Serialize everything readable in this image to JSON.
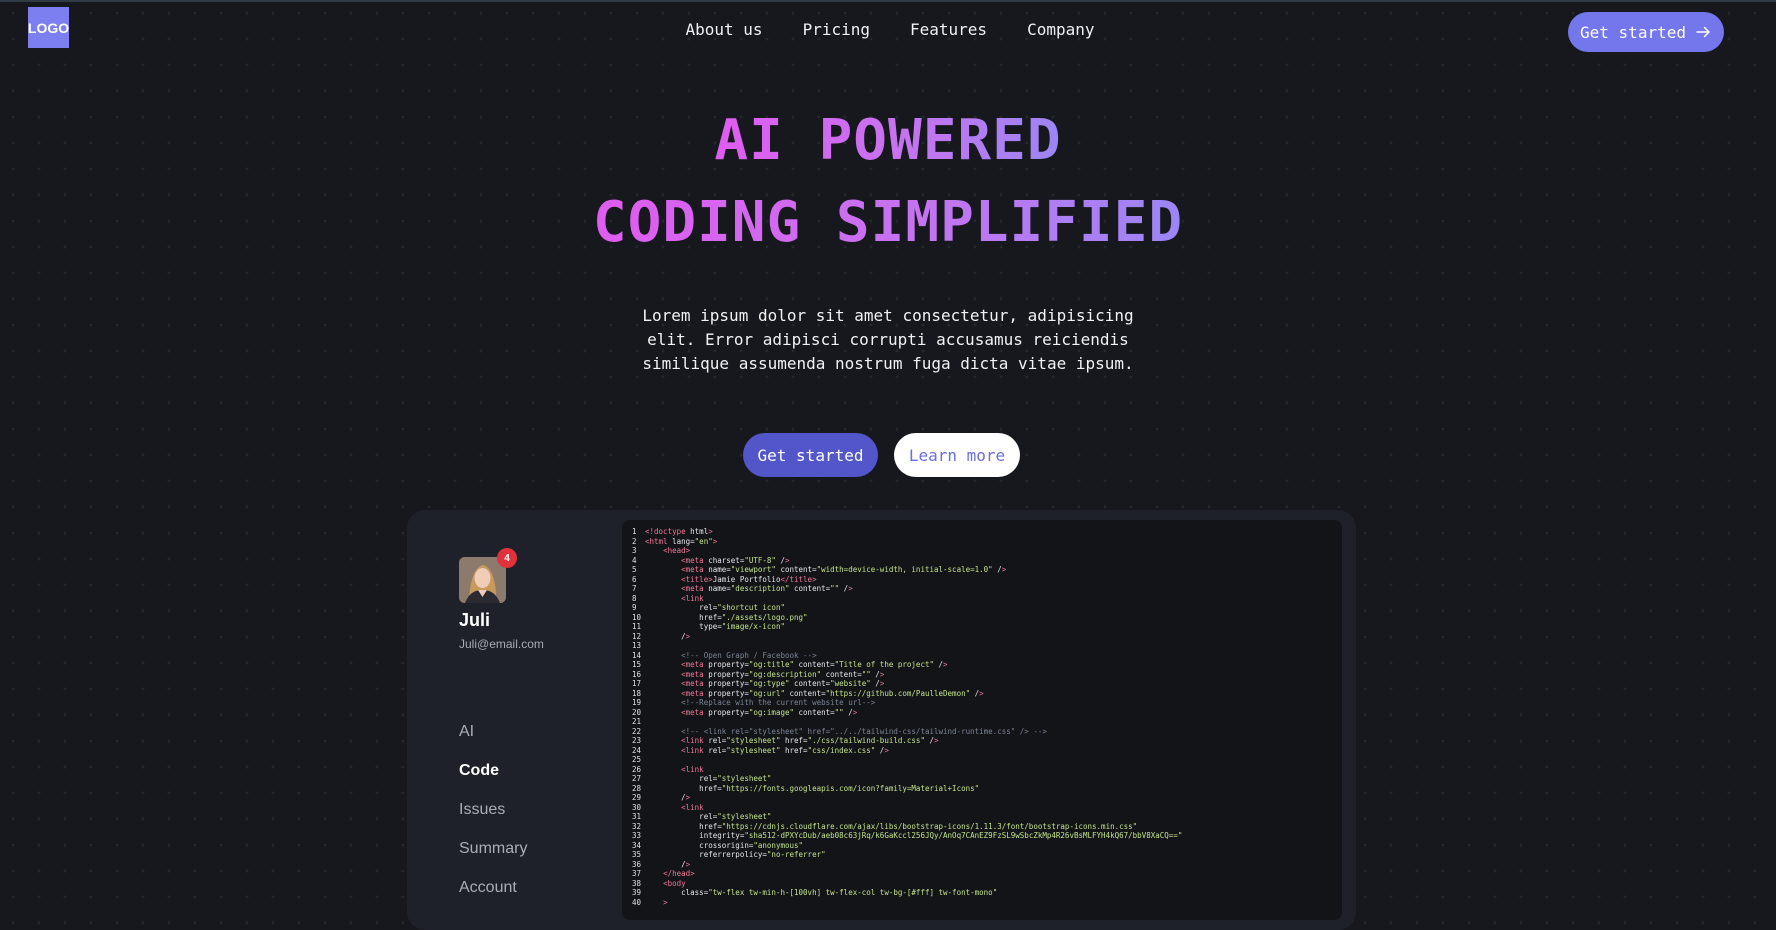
{
  "nav": {
    "logo": "LOGO",
    "links": [
      "About us",
      "Pricing",
      "Features",
      "Company"
    ],
    "cta": "Get started",
    "cta_icon": "arrow-right-icon"
  },
  "hero": {
    "title_line1": "AI POWERED",
    "title_line2": "CODING SIMPLIFIED",
    "subtitle": "Lorem ipsum dolor sit amet consectetur, adipisicing elit. Error adipisci corrupti accusamus reiciendis similique assumenda nostrum fuga dicta vitae ipsum.",
    "primary_button": "Get started",
    "secondary_button": "Learn more"
  },
  "profile": {
    "notification_count": "4",
    "name": "Juli",
    "email": "Juli@email.com"
  },
  "sidebar": {
    "items": [
      "AI",
      "Code",
      "Issues",
      "Summary",
      "Account"
    ],
    "active": "Code"
  },
  "colors": {
    "accent": "#7476ec",
    "button_primary": "#5356c9",
    "badge": "#e0323a",
    "gradient_start": "#e05cf0",
    "gradient_end": "#9b86f5"
  },
  "code": {
    "lines": [
      "<!doctype html>",
      "<html lang=\"en\">",
      "    <head>",
      "        <meta charset=\"UTF-8\" />",
      "        <meta name=\"viewport\" content=\"width=device-width, initial-scale=1.0\" />",
      "        <title>Jamie Portfolio</title>",
      "        <meta name=\"description\" content=\"\" />",
      "        <link",
      "            rel=\"shortcut icon\"",
      "            href=\"./assets/logo.png\"",
      "            type=\"image/x-icon\"",
      "        />",
      "",
      "        <!-- Open Graph / Facebook -->",
      "        <meta property=\"og:title\" content=\"Title of the project\" />",
      "        <meta property=\"og:description\" content=\"\" />",
      "        <meta property=\"og:type\" content=\"website\" />",
      "        <meta property=\"og:url\" content=\"https://github.com/PaulleDemon\" />",
      "        <!--Replace with the current website url-->",
      "        <meta property=\"og:image\" content=\"\" />",
      "",
      "        <!-- <link rel=\"stylesheet\" href=\"../../tailwind-css/tailwind-runtime.css\" /> -->",
      "        <link rel=\"stylesheet\" href=\"./css/tailwind-build.css\" />",
      "        <link rel=\"stylesheet\" href=\"css/index.css\" />",
      "",
      "        <link",
      "            rel=\"stylesheet\"",
      "            href=\"https://fonts.googleapis.com/icon?family=Material+Icons\"",
      "        />",
      "        <link",
      "            rel=\"stylesheet\"",
      "            href=\"https://cdnjs.cloudflare.com/ajax/libs/bootstrap-icons/1.11.3/font/bootstrap-icons.min.css\"",
      "            integrity=\"sha512-dPXYcDub/aeb08c63jRq/k6GaKccl256JQy/AnOq7CAnEZ9FzSL9wSbcZkMp4R26vBsMLFYH4kQ67/bbV8XaCQ==\"",
      "            crossorigin=\"anonymous\"",
      "            referrerpolicy=\"no-referrer\"",
      "        />",
      "    </head>",
      "    <body",
      "        class=\"tw-flex tw-min-h-[100vh] tw-flex-col tw-bg-[#fff] tw-font-mono\"",
      "    >"
    ]
  }
}
